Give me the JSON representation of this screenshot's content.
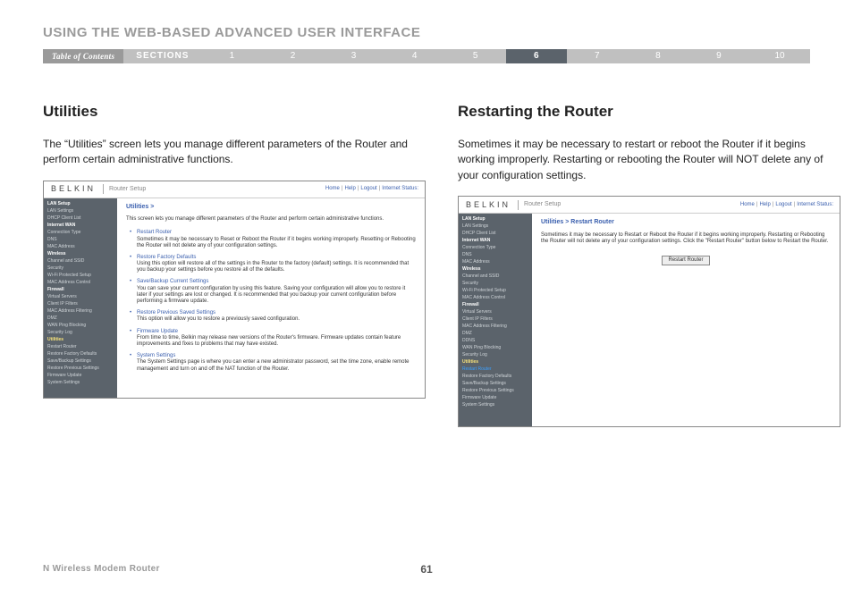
{
  "header": "USING THE WEB-BASED ADVANCED USER INTERFACE",
  "nav": {
    "toc": "Table of Contents",
    "sections": "SECTIONS",
    "numbers": [
      "1",
      "2",
      "3",
      "4",
      "5",
      "6",
      "7",
      "8",
      "9",
      "10"
    ],
    "active": "6"
  },
  "left": {
    "title": "Utilities",
    "body": "The “Utilities” screen lets you manage different parameters of the Router and perform certain administrative functions."
  },
  "right": {
    "title": "Restarting the Router",
    "body": "Sometimes it may be necessary to restart or reboot the Router if it begins working improperly. Restarting or rebooting the Router will NOT delete any of your configuration settings."
  },
  "ss_shared": {
    "logo": "BELKIN",
    "setup": "Router Setup",
    "toplinks": [
      "Home",
      "Help",
      "Logout",
      "Internet Status:"
    ]
  },
  "ssA": {
    "crumb": "Utilities >",
    "intro": "This screen lets you manage different parameters of the Router and perform certain administrative functions.",
    "sidebar": [
      {
        "t": "LAN Setup",
        "c": "hdr"
      },
      {
        "t": "LAN Settings"
      },
      {
        "t": "DHCP Client List"
      },
      {
        "t": "Internet WAN",
        "c": "hdr"
      },
      {
        "t": "Connection Type"
      },
      {
        "t": "DNS"
      },
      {
        "t": "MAC Address"
      },
      {
        "t": "Wireless",
        "c": "hdr"
      },
      {
        "t": "Channel and SSID"
      },
      {
        "t": "Security"
      },
      {
        "t": "Wi-Fi Protected Setup"
      },
      {
        "t": "MAC Address Control"
      },
      {
        "t": "Firewall",
        "c": "hdr"
      },
      {
        "t": "Virtual Servers"
      },
      {
        "t": "Client IP Filters"
      },
      {
        "t": "MAC Address Filtering"
      },
      {
        "t": "DMZ"
      },
      {
        "t": "WAN Ping Blocking"
      },
      {
        "t": "Security Log"
      },
      {
        "t": "Utilities",
        "c": "hi"
      },
      {
        "t": "Restart Router"
      },
      {
        "t": "Restore Factory Defaults"
      },
      {
        "t": "Save/Backup Settings"
      },
      {
        "t": "Restore Previous Settings"
      },
      {
        "t": "Firmware Update"
      },
      {
        "t": "System Settings"
      }
    ],
    "items": [
      {
        "t": "Restart Router",
        "d": "Sometimes it may be necessary to Reset or Reboot the Router if it begins working improperly. Resetting or Rebooting the Router will not delete any of your configuration settings."
      },
      {
        "t": "Restore Factory Defaults",
        "d": "Using this option will restore all of the settings in the Router to the factory (default) settings. It is recommended that you backup your settings before you restore all of the defaults."
      },
      {
        "t": "Save/Backup Current Settings",
        "d": "You can save your current configuration by using this feature. Saving your configuration will allow you to restore it later if your settings are lost or changed. It is recommended that you backup your current configuration before performing a firmware update."
      },
      {
        "t": "Restore Previous Saved Settings",
        "d": "This option will allow you to restore a previously saved configuration."
      },
      {
        "t": "Firmware Update",
        "d": "From time to time, Belkin may release new versions of the Router's firmware. Firmware updates contain feature improvements and fixes to problems that may have existed."
      },
      {
        "t": "System Settings",
        "d": "The System Settings page is where you can enter a new administrator password, set the time zone, enable remote management and turn on and off the NAT function of the Router."
      }
    ]
  },
  "ssB": {
    "crumb": "Utilities > Restart Router",
    "intro": "Sometimes it may be necessary to Restart or Reboot the Router if it begins working improperly. Restarting or Rebooting the Router will not delete any of your configuration settings. Click the \"Restart Router\" button below to Restart the Router.",
    "button": "Restart Router",
    "sidebar": [
      {
        "t": "LAN Setup",
        "c": "hdr"
      },
      {
        "t": "LAN Settings"
      },
      {
        "t": "DHCP Client List"
      },
      {
        "t": "Internet WAN",
        "c": "hdr"
      },
      {
        "t": "Connection Type"
      },
      {
        "t": "DNS"
      },
      {
        "t": "MAC Address"
      },
      {
        "t": "Wireless",
        "c": "hdr"
      },
      {
        "t": "Channel and SSID"
      },
      {
        "t": "Security"
      },
      {
        "t": "Wi-Fi Protected Setup"
      },
      {
        "t": "MAC Address Control"
      },
      {
        "t": "Firewall",
        "c": "hdr"
      },
      {
        "t": "Virtual Servers"
      },
      {
        "t": "Client IP Filters"
      },
      {
        "t": "MAC Address Filtering"
      },
      {
        "t": "DMZ"
      },
      {
        "t": "DDNS"
      },
      {
        "t": "WAN Ping Blocking"
      },
      {
        "t": "Security Log"
      },
      {
        "t": "Utilities",
        "c": "hi"
      },
      {
        "t": "Restart Router",
        "c": "sel"
      },
      {
        "t": "Restore Factory Defaults"
      },
      {
        "t": "Save/Backup Settings"
      },
      {
        "t": "Restore Previous Settings"
      },
      {
        "t": "Firmware Update"
      },
      {
        "t": "System Settings"
      }
    ]
  },
  "footer": {
    "title": "N Wireless Modem Router",
    "page": "61"
  }
}
